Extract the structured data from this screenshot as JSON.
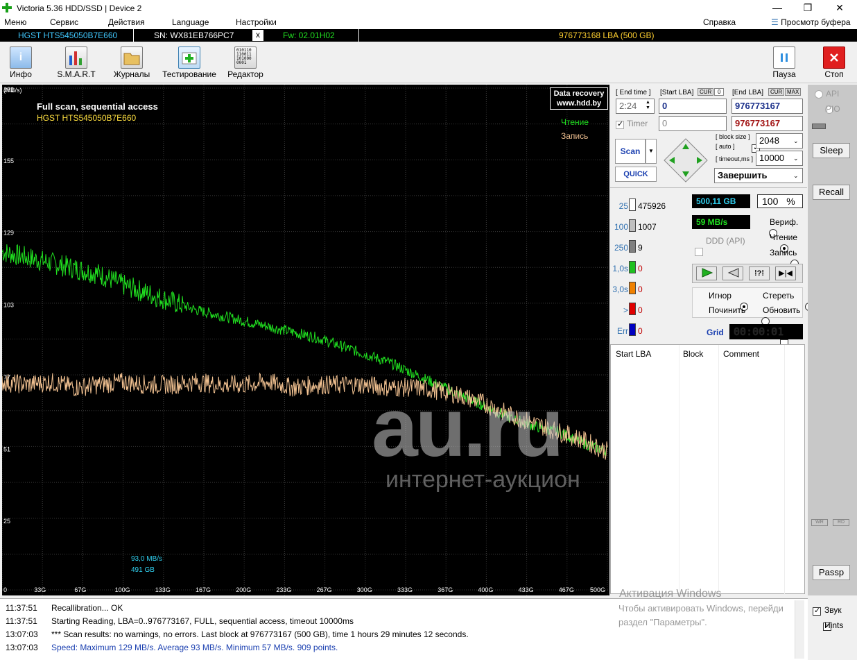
{
  "window": {
    "title": "Victoria 5.36 HDD/SSD | Device 2",
    "minimize": "—",
    "maximize": "❐",
    "close": "✕"
  },
  "menu": {
    "items": [
      "Меню",
      "Сервис",
      "Действия",
      "Language",
      "Настройки"
    ],
    "help": "Справка",
    "clipboard": "Просмотр буфера"
  },
  "device": {
    "model": "HGST HTS545050B7E660",
    "serial": "SN: WX81EB766PC7",
    "close": "x",
    "firmware": "Fw: 02.01H02",
    "capacity": "976773168 LBA (500 GB)"
  },
  "toolbar": {
    "info": "Инфо",
    "smart": "S.M.A.R.T",
    "logs": "Журналы",
    "testing": "Тестирование",
    "editor": "Редактор",
    "editor_icon_text": "010110\n110011\n101000\n0001",
    "pause": "Пауза",
    "stop": "Стоп"
  },
  "chart_data": {
    "type": "line",
    "title": "Full scan, sequential access",
    "subtitle": "HGST HTS545050B7E660",
    "ylabel": "(MB/s)",
    "y_ticks": [
      "181",
      "155",
      "129",
      "103",
      "77",
      "51",
      "25"
    ],
    "x_ticks": [
      "0",
      "33G",
      "67G",
      "100G",
      "133G",
      "167G",
      "200G",
      "233G",
      "267G",
      "300G",
      "333G",
      "367G",
      "400G",
      "433G",
      "467G",
      "500G"
    ],
    "xlim": [
      0,
      500
    ],
    "ylim": [
      0,
      181
    ],
    "grid": true,
    "legend_position": "top-right",
    "badge": "Data recovery\nwww.hdd.by",
    "series": [
      {
        "name": "Чтение",
        "color": "#20e020",
        "x": [
          0,
          20,
          40,
          60,
          80,
          100,
          120,
          140,
          160,
          180,
          200,
          220,
          240,
          260,
          280,
          300,
          320,
          340,
          360,
          380,
          400,
          420,
          440,
          460,
          480,
          500
        ],
        "values": [
          122,
          120,
          118,
          116,
          114,
          110,
          107,
          104,
          101,
          99,
          97,
          95,
          93,
          91,
          88,
          85,
          82,
          78,
          74,
          70,
          66,
          62,
          59,
          57,
          53,
          50
        ]
      },
      {
        "name": "Запись",
        "color": "#f0c090",
        "x": [
          0,
          20,
          40,
          60,
          80,
          100,
          120,
          140,
          160,
          180,
          200,
          220,
          240,
          260,
          280,
          300,
          320,
          340,
          360,
          380,
          400,
          420,
          440,
          460,
          480,
          500
        ],
        "values": [
          75,
          74,
          75,
          73,
          74,
          75,
          74,
          74,
          75,
          74,
          74,
          75,
          73,
          74,
          74,
          74,
          73,
          73,
          72,
          70,
          67,
          63,
          60,
          57,
          54,
          50
        ]
      }
    ],
    "annotations": [
      "93,0 MB/s",
      "491 GB"
    ]
  },
  "legend": {
    "read": "Чтение",
    "write": "Запись"
  },
  "watermark": {
    "big": "au.ru",
    "small": "интернет-аукцион"
  },
  "controls": {
    "end_time_label": "[ End time ]",
    "end_time": "2:24",
    "start_lba_label": "[Start LBA]",
    "cur": "CUR",
    "zero": "0",
    "start_lba": "0",
    "end_lba_label": "[End LBA]",
    "max": "MAX",
    "end_lba": "976773167",
    "end_lba2": "976773167",
    "timer_label": "Timer",
    "timer_value": "0",
    "scan": "Scan",
    "quick": "QUICK",
    "block_size_label": "[ block size ]",
    "auto_label": "[ auto ]",
    "block_size": "2048",
    "timeout_label": "[ timeout,ms ]",
    "timeout": "10000",
    "finish": "Завершить"
  },
  "stats": {
    "rows": [
      {
        "label": "25",
        "count": "475926",
        "color": "#ffffff",
        "label_color": "#3070b0"
      },
      {
        "label": "100",
        "count": "1007",
        "color": "#c0c0c0",
        "label_color": "#3070b0"
      },
      {
        "label": "250",
        "count": "9",
        "color": "#808080",
        "label_color": "#3070b0"
      },
      {
        "label": "1,0s",
        "count": "0",
        "color": "#20c020",
        "label_color": "#3070b0"
      },
      {
        "label": "3,0s",
        "count": "0",
        "color": "#f08000",
        "label_color": "#3070b0"
      },
      {
        "label": ">",
        "count": "0",
        "color": "#e00000",
        "label_color": "#3070b0"
      },
      {
        "label": "Err",
        "count": "0",
        "color": "#0000c0",
        "label_color": "#3070b0"
      }
    ],
    "position": "500,11 GB",
    "percent": "100",
    "percent_sign": "%",
    "speed": "59 MB/s",
    "ddd": "DDD (API)",
    "verify": "Вериф.",
    "read": "Чтение",
    "write": "Запись",
    "ignore": "Игнор",
    "erase": "Стереть",
    "remap": "Починить",
    "refresh": "Обновить",
    "grid": "Grid",
    "clock": "00:00:01"
  },
  "table": {
    "columns": [
      "Start LBA",
      "Block",
      "Comment"
    ]
  },
  "side": {
    "api": "API",
    "pio": "PIO",
    "sleep": "Sleep",
    "recall": "Recall",
    "passp": "Passp",
    "wr1": "WR",
    "wr2": "RD",
    "sound": "Звук",
    "hints": "Hints"
  },
  "activation": {
    "title": "Активация Windows",
    "line1": "Чтобы активировать Windows, перейди",
    "line2": "раздел \"Параметры\"."
  },
  "log": [
    {
      "time": "11:37:51",
      "text": "Recallibration... OK",
      "color": "#000"
    },
    {
      "time": "11:37:51",
      "text": "Starting Reading, LBA=0..976773167, FULL, sequential access, timeout 10000ms",
      "color": "#000"
    },
    {
      "time": "13:07:03",
      "text": "*** Scan results: no warnings, no errors. Last block at 976773167 (500 GB), time 1 hours 29 minutes 12 seconds.",
      "color": "#000"
    },
    {
      "time": "13:07:03",
      "text": "Speed: Maximum 129 MB/s. Average 93 MB/s. Minimum 57 MB/s. 909 points.",
      "color": "#1a3fb0"
    }
  ]
}
